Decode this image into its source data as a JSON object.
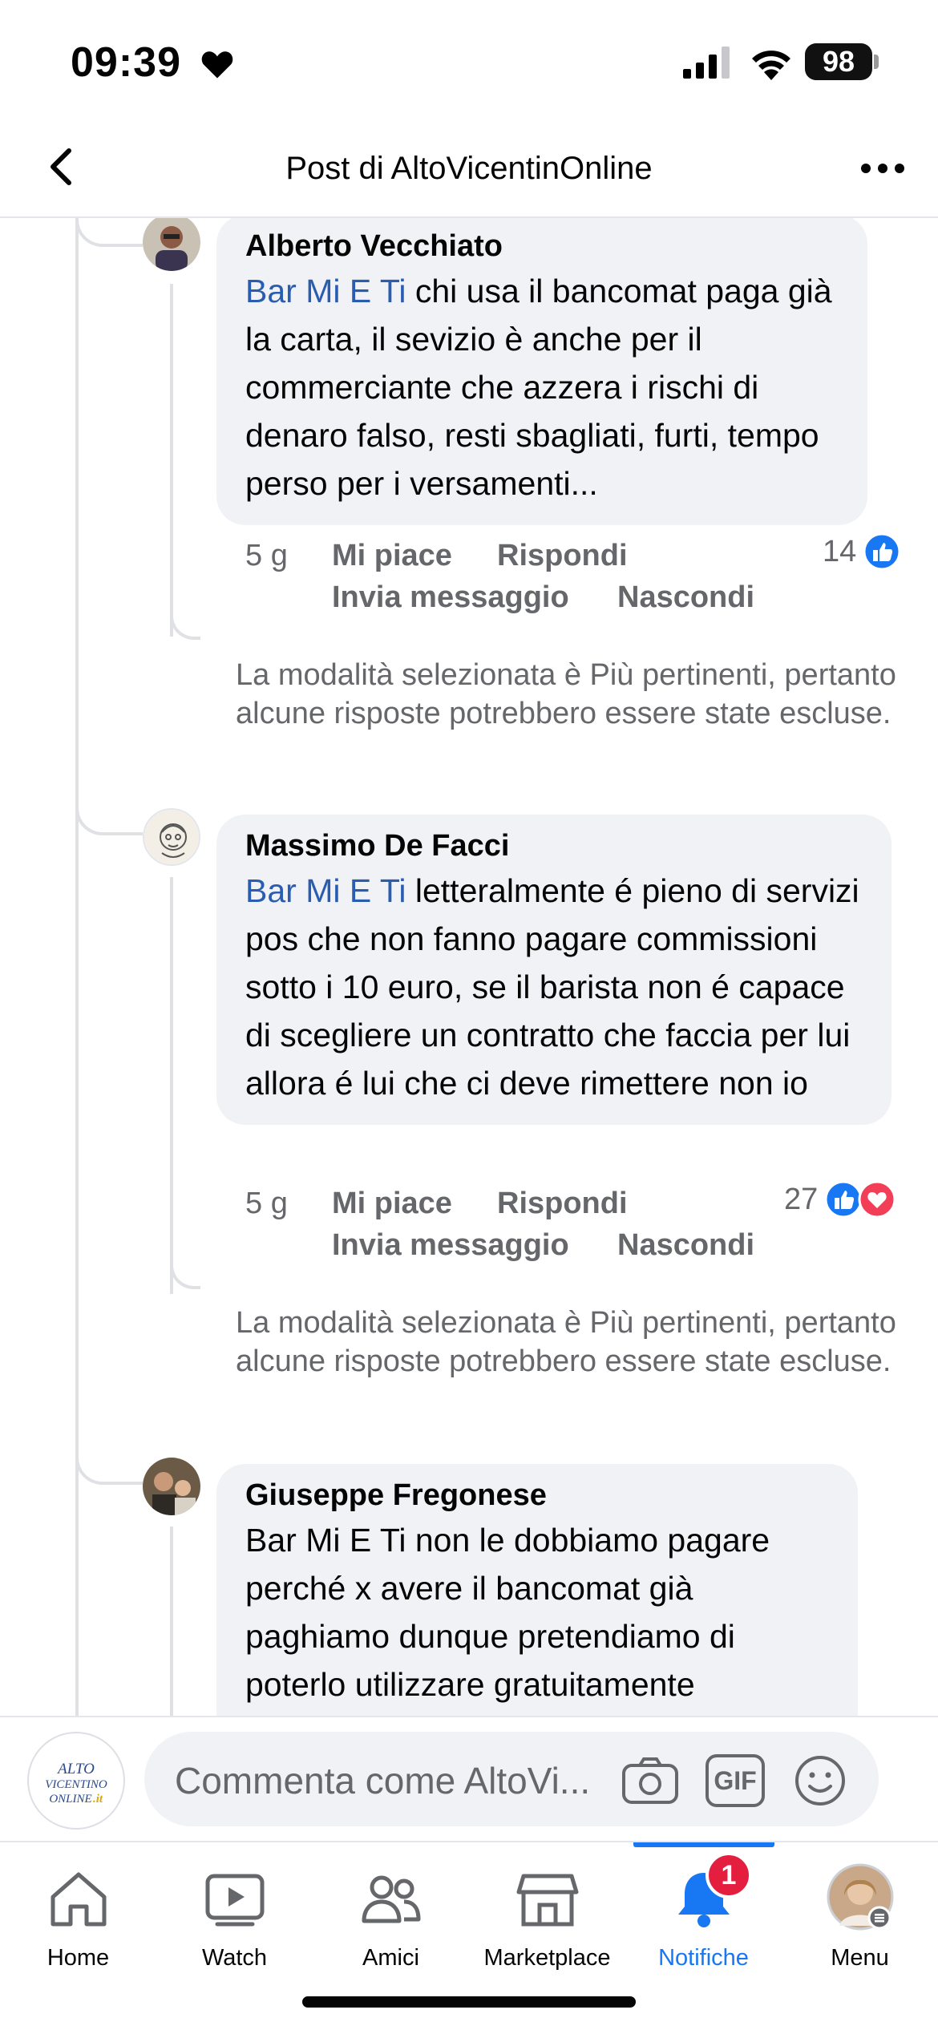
{
  "status_bar": {
    "time": "09:39",
    "battery": "98"
  },
  "header": {
    "title": "Post di AltoVicentinOnline"
  },
  "comments": [
    {
      "author": "Alberto Vecchiato",
      "mention": "Bar Mi E Ti",
      "text": " chi usa il bancomat paga già la carta, il sevizio è anche per il commerciante che azzera i rischi di denaro falso, resti sbagliati, furti, tempo perso per i versamenti...",
      "time": "5 g",
      "like": "Mi piace",
      "reply": "Rispondi",
      "message": "Invia messaggio",
      "hide": "Nascondi",
      "reaction_count": "14",
      "reactions": [
        "like-icon"
      ],
      "notice": "La modalità selezionata è Più pertinenti, pertanto alcune risposte potrebbero essere state escluse."
    },
    {
      "author": "Massimo De Facci",
      "mention": "Bar Mi E Ti",
      "text": " letteralmente é pieno di servizi pos che non fanno pagare commissioni sotto i 10 euro, se il barista non é capace di scegliere un contratto che faccia per lui allora é lui che ci deve rimettere non io",
      "time": "5 g",
      "like": "Mi piace",
      "reply": "Rispondi",
      "message": "Invia messaggio",
      "hide": "Nascondi",
      "reaction_count": "27",
      "reactions": [
        "like-icon",
        "love-icon"
      ],
      "notice": "La modalità selezionata è Più pertinenti, pertanto alcune risposte potrebbero essere state escluse."
    },
    {
      "author": "Giuseppe Fregonese",
      "text": "Bar Mi E Ti non le dobbiamo pagare perché x avere il bancomat già paghiamo dunque pretendiamo di poterlo utilizzare gratuitamente"
    }
  ],
  "composer": {
    "placeholder": "Commenta come AltoVi...",
    "page_logo_text": "ALTO VICENTINO ONLINE .it",
    "gif_label": "GIF"
  },
  "tabbar": {
    "tabs": [
      {
        "label": "Home",
        "icon": "home-icon"
      },
      {
        "label": "Watch",
        "icon": "watch-icon"
      },
      {
        "label": "Amici",
        "icon": "friends-icon"
      },
      {
        "label": "Marketplace",
        "icon": "marketplace-icon"
      },
      {
        "label": "Notifiche",
        "icon": "bell-icon",
        "active": true
      },
      {
        "label": "Menu",
        "icon": "profile-avatar"
      }
    ],
    "notifications_badge": "1"
  },
  "colors": {
    "accent": "#1877f2",
    "mention": "#2a5db0",
    "badge": "#e41e3f",
    "bubble": "#f0f2f5"
  }
}
